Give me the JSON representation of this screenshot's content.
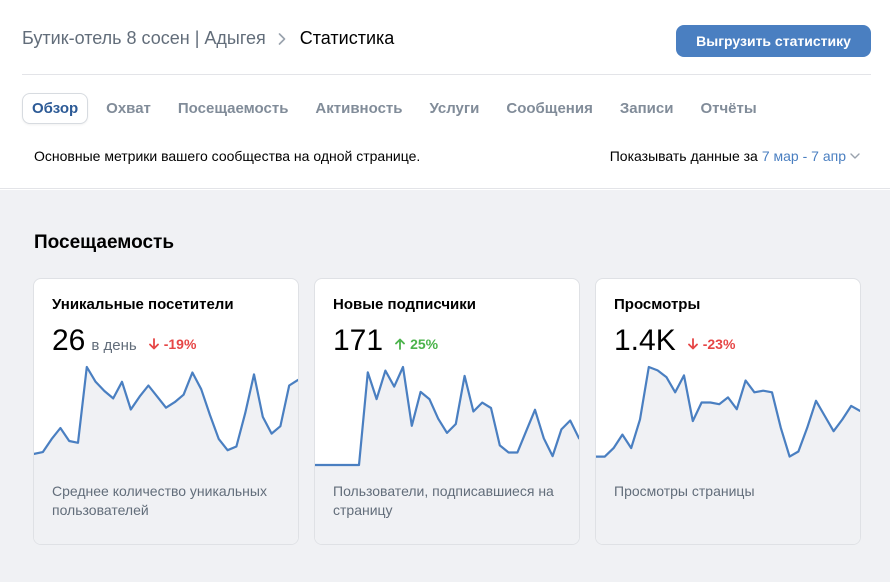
{
  "header": {
    "community_name": "Бутик-отель 8 сосен | Адыгея",
    "page_title": "Статистика",
    "export_label": "Выгрузить статистику"
  },
  "tabs": [
    {
      "label": "Обзор",
      "active": true
    },
    {
      "label": "Охват",
      "active": false
    },
    {
      "label": "Посещаемость",
      "active": false
    },
    {
      "label": "Активность",
      "active": false
    },
    {
      "label": "Услуги",
      "active": false
    },
    {
      "label": "Сообщения",
      "active": false
    },
    {
      "label": "Записи",
      "active": false
    },
    {
      "label": "Отчёты",
      "active": false
    }
  ],
  "description": "Основные метрики вашего сообщества на одной странице.",
  "period": {
    "prefix": "Показывать данные за",
    "value": "7 мар - 7 апр"
  },
  "section": {
    "title": "Посещаемость"
  },
  "cards": [
    {
      "title": "Уникальные посетители",
      "value": "26",
      "unit": "в день",
      "delta": "-19%",
      "delta_direction": "down",
      "footer": "Среднее количество уникальных пользователей",
      "series": [
        6,
        7,
        14,
        20,
        13,
        12,
        53,
        45,
        40,
        36,
        45,
        30,
        37,
        43,
        37,
        31,
        34,
        38,
        50,
        41,
        27,
        14,
        8,
        10,
        28,
        49,
        26,
        17,
        21,
        43,
        46
      ]
    },
    {
      "title": "Новые подписчики",
      "value": "171",
      "unit": "",
      "delta": "25%",
      "delta_direction": "up",
      "footer": "Пользователи, подписавшиеся на страницу",
      "series": [
        0,
        0,
        0,
        0,
        0,
        0,
        52,
        37,
        53,
        44,
        55,
        22,
        41,
        37,
        26,
        18,
        23,
        50,
        30,
        35,
        32,
        11,
        7,
        7,
        19,
        31,
        15,
        5,
        20,
        25,
        15
      ]
    },
    {
      "title": "Просмотры",
      "value": "1.4K",
      "unit": "",
      "delta": "-23%",
      "delta_direction": "down",
      "footer": "Просмотры страницы",
      "series": [
        5,
        5,
        10,
        18,
        10,
        27,
        58,
        56,
        52,
        43,
        53,
        26,
        37,
        37,
        36,
        40,
        33,
        50,
        43,
        44,
        43,
        22,
        5,
        8,
        22,
        38,
        29,
        20,
        27,
        35,
        32
      ]
    }
  ],
  "colors": {
    "accent": "#4a7fc1",
    "line": "#4a7fc1",
    "down": "#e64646",
    "up": "#4bb34b",
    "background": "#f0f1f4"
  }
}
